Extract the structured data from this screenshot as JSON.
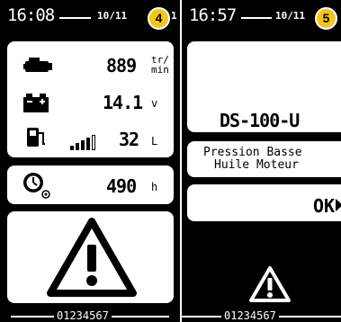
{
  "screen1": {
    "time": "16:08",
    "date": "10/11",
    "date_trailing": "1",
    "step": "4",
    "engine": {
      "icon": "engine-icon",
      "value": "889",
      "unit_top": "tr/",
      "unit_bottom": "min"
    },
    "battery": {
      "icon": "battery-icon",
      "value": "14.1",
      "unit": "v"
    },
    "fuel": {
      "icon": "fuel-icon",
      "level_bars_filled": 4,
      "level_bars_total": 5,
      "value": "32",
      "unit": "L"
    },
    "hours": {
      "icon": "hour-meter-icon",
      "value": "490",
      "unit": "h"
    },
    "alarm_icon": "warning-triangle-icon",
    "serial": "01234567"
  },
  "screen2": {
    "time": "16:57",
    "date": "10/11",
    "step": "5",
    "model": "DS-100-U",
    "message_line1": "Pression Basse",
    "message_line2": "Huile Moteur",
    "ok_label": "OK",
    "alarm_icon": "warning-triangle-icon",
    "serial": "01234567"
  }
}
